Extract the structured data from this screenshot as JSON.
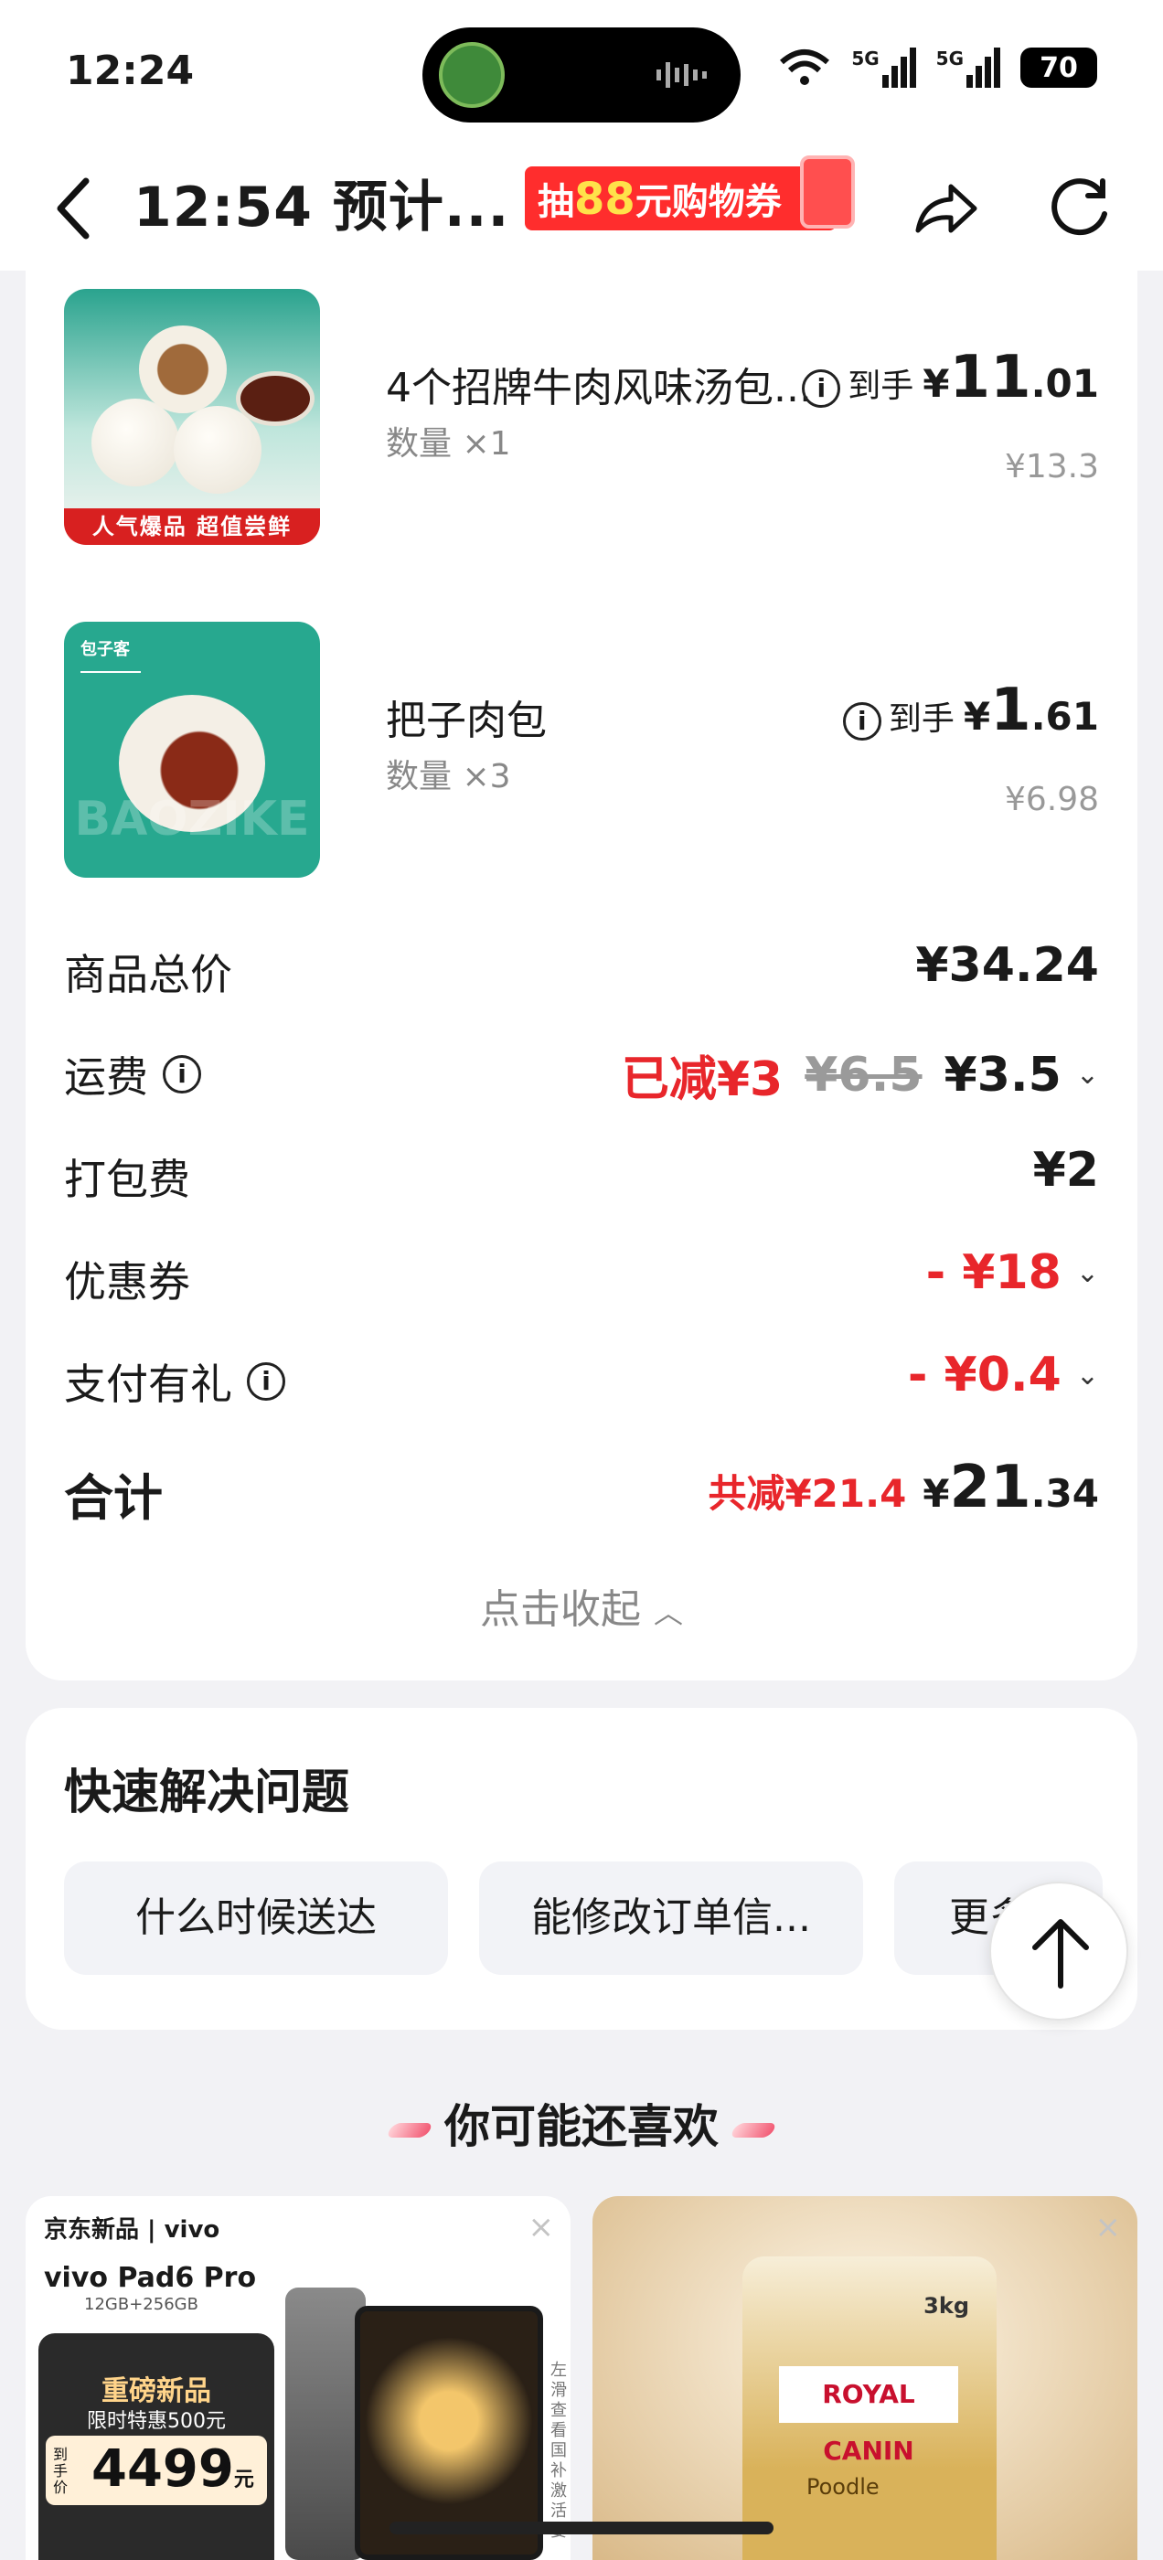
{
  "status_bar": {
    "time": "12:24",
    "signal1": "5G",
    "signal2": "5G",
    "battery": "70"
  },
  "navbar": {
    "title": "12:54 预计...",
    "promo_prefix": "抽",
    "promo_amount": "88",
    "promo_suffix": "元购物券"
  },
  "items": [
    {
      "name": "4个招牌牛肉风味汤包...",
      "qty": "数量 ×1",
      "price_prefix": "到手",
      "currency": "¥",
      "price_int": "11",
      "price_dec": ".01",
      "orig_price": "¥13.3",
      "image_banner": "人气爆品 超值尝鲜"
    },
    {
      "name": "把子肉包",
      "qty": "数量 ×3",
      "price_prefix": "到手",
      "currency": "¥",
      "price_int": "1",
      "price_dec": ".61",
      "orig_price": "¥6.98",
      "image_logo": "包子客",
      "image_watermark": "BAOZIKE"
    }
  ],
  "summary": {
    "goods_total_label": "商品总价",
    "goods_total": "¥34.24",
    "delivery_label": "运费",
    "delivery_discount": "已减¥3",
    "delivery_orig": "¥6.5",
    "delivery_fee": "¥3.5",
    "packing_label": "打包费",
    "packing_fee": "¥2",
    "coupon_label": "优惠券",
    "coupon_value": "- ¥18",
    "pay_gift_label": "支付有礼",
    "pay_gift_value": "- ¥0.4",
    "total_label": "合计",
    "total_saved": "共减¥21.4",
    "total_currency": "¥",
    "total_int": "21",
    "total_dec": ".34",
    "collapse_label": "点击收起"
  },
  "quick_help": {
    "title": "快速解决问题",
    "buttons": [
      "什么时候送达",
      "能修改订单信...",
      "更多"
    ]
  },
  "recommend": {
    "title": "你可能还喜欢",
    "left": {
      "brand": "京东新品 | vivo",
      "product": "vivo Pad6 Pro",
      "spec": "12GB+256GB",
      "tag1": "重磅新品",
      "tag2": "限时特惠500元",
      "price_label": "到手价",
      "price": "4499",
      "price_unit": "元",
      "side_text": "左滑查看国补激活要"
    },
    "right": {
      "brand": "ROYAL CANIN",
      "weight": "3kg",
      "kind": "Poodle"
    }
  },
  "colors": {
    "accent_red": "#e8262b",
    "background": "#f2f2f5"
  }
}
